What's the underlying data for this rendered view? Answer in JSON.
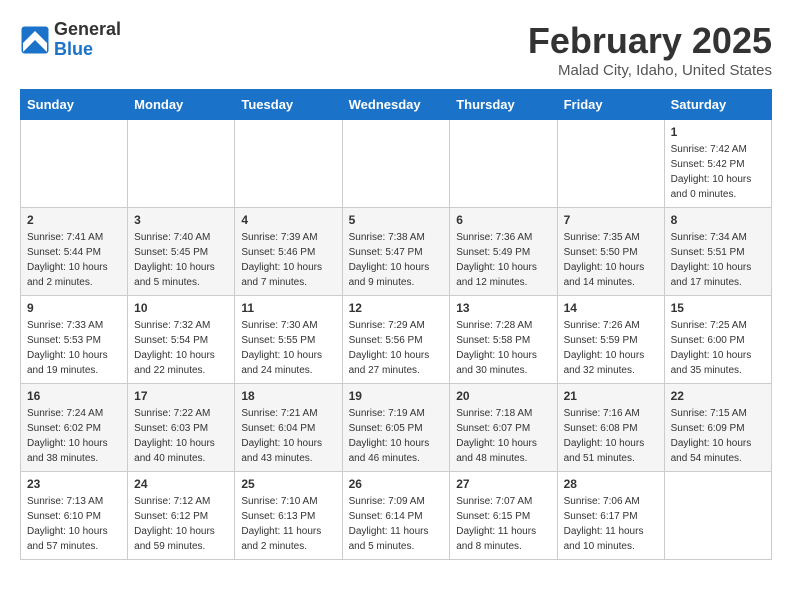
{
  "header": {
    "logo_general": "General",
    "logo_blue": "Blue",
    "month_title": "February 2025",
    "location": "Malad City, Idaho, United States"
  },
  "weekdays": [
    "Sunday",
    "Monday",
    "Tuesday",
    "Wednesday",
    "Thursday",
    "Friday",
    "Saturday"
  ],
  "weeks": [
    {
      "days": [
        {
          "num": "",
          "info": ""
        },
        {
          "num": "",
          "info": ""
        },
        {
          "num": "",
          "info": ""
        },
        {
          "num": "",
          "info": ""
        },
        {
          "num": "",
          "info": ""
        },
        {
          "num": "",
          "info": ""
        },
        {
          "num": "1",
          "info": "Sunrise: 7:42 AM\nSunset: 5:42 PM\nDaylight: 10 hours\nand 0 minutes."
        }
      ]
    },
    {
      "days": [
        {
          "num": "2",
          "info": "Sunrise: 7:41 AM\nSunset: 5:44 PM\nDaylight: 10 hours\nand 2 minutes."
        },
        {
          "num": "3",
          "info": "Sunrise: 7:40 AM\nSunset: 5:45 PM\nDaylight: 10 hours\nand 5 minutes."
        },
        {
          "num": "4",
          "info": "Sunrise: 7:39 AM\nSunset: 5:46 PM\nDaylight: 10 hours\nand 7 minutes."
        },
        {
          "num": "5",
          "info": "Sunrise: 7:38 AM\nSunset: 5:47 PM\nDaylight: 10 hours\nand 9 minutes."
        },
        {
          "num": "6",
          "info": "Sunrise: 7:36 AM\nSunset: 5:49 PM\nDaylight: 10 hours\nand 12 minutes."
        },
        {
          "num": "7",
          "info": "Sunrise: 7:35 AM\nSunset: 5:50 PM\nDaylight: 10 hours\nand 14 minutes."
        },
        {
          "num": "8",
          "info": "Sunrise: 7:34 AM\nSunset: 5:51 PM\nDaylight: 10 hours\nand 17 minutes."
        }
      ]
    },
    {
      "days": [
        {
          "num": "9",
          "info": "Sunrise: 7:33 AM\nSunset: 5:53 PM\nDaylight: 10 hours\nand 19 minutes."
        },
        {
          "num": "10",
          "info": "Sunrise: 7:32 AM\nSunset: 5:54 PM\nDaylight: 10 hours\nand 22 minutes."
        },
        {
          "num": "11",
          "info": "Sunrise: 7:30 AM\nSunset: 5:55 PM\nDaylight: 10 hours\nand 24 minutes."
        },
        {
          "num": "12",
          "info": "Sunrise: 7:29 AM\nSunset: 5:56 PM\nDaylight: 10 hours\nand 27 minutes."
        },
        {
          "num": "13",
          "info": "Sunrise: 7:28 AM\nSunset: 5:58 PM\nDaylight: 10 hours\nand 30 minutes."
        },
        {
          "num": "14",
          "info": "Sunrise: 7:26 AM\nSunset: 5:59 PM\nDaylight: 10 hours\nand 32 minutes."
        },
        {
          "num": "15",
          "info": "Sunrise: 7:25 AM\nSunset: 6:00 PM\nDaylight: 10 hours\nand 35 minutes."
        }
      ]
    },
    {
      "days": [
        {
          "num": "16",
          "info": "Sunrise: 7:24 AM\nSunset: 6:02 PM\nDaylight: 10 hours\nand 38 minutes."
        },
        {
          "num": "17",
          "info": "Sunrise: 7:22 AM\nSunset: 6:03 PM\nDaylight: 10 hours\nand 40 minutes."
        },
        {
          "num": "18",
          "info": "Sunrise: 7:21 AM\nSunset: 6:04 PM\nDaylight: 10 hours\nand 43 minutes."
        },
        {
          "num": "19",
          "info": "Sunrise: 7:19 AM\nSunset: 6:05 PM\nDaylight: 10 hours\nand 46 minutes."
        },
        {
          "num": "20",
          "info": "Sunrise: 7:18 AM\nSunset: 6:07 PM\nDaylight: 10 hours\nand 48 minutes."
        },
        {
          "num": "21",
          "info": "Sunrise: 7:16 AM\nSunset: 6:08 PM\nDaylight: 10 hours\nand 51 minutes."
        },
        {
          "num": "22",
          "info": "Sunrise: 7:15 AM\nSunset: 6:09 PM\nDaylight: 10 hours\nand 54 minutes."
        }
      ]
    },
    {
      "days": [
        {
          "num": "23",
          "info": "Sunrise: 7:13 AM\nSunset: 6:10 PM\nDaylight: 10 hours\nand 57 minutes."
        },
        {
          "num": "24",
          "info": "Sunrise: 7:12 AM\nSunset: 6:12 PM\nDaylight: 10 hours\nand 59 minutes."
        },
        {
          "num": "25",
          "info": "Sunrise: 7:10 AM\nSunset: 6:13 PM\nDaylight: 11 hours\nand 2 minutes."
        },
        {
          "num": "26",
          "info": "Sunrise: 7:09 AM\nSunset: 6:14 PM\nDaylight: 11 hours\nand 5 minutes."
        },
        {
          "num": "27",
          "info": "Sunrise: 7:07 AM\nSunset: 6:15 PM\nDaylight: 11 hours\nand 8 minutes."
        },
        {
          "num": "28",
          "info": "Sunrise: 7:06 AM\nSunset: 6:17 PM\nDaylight: 11 hours\nand 10 minutes."
        },
        {
          "num": "",
          "info": ""
        }
      ]
    }
  ]
}
